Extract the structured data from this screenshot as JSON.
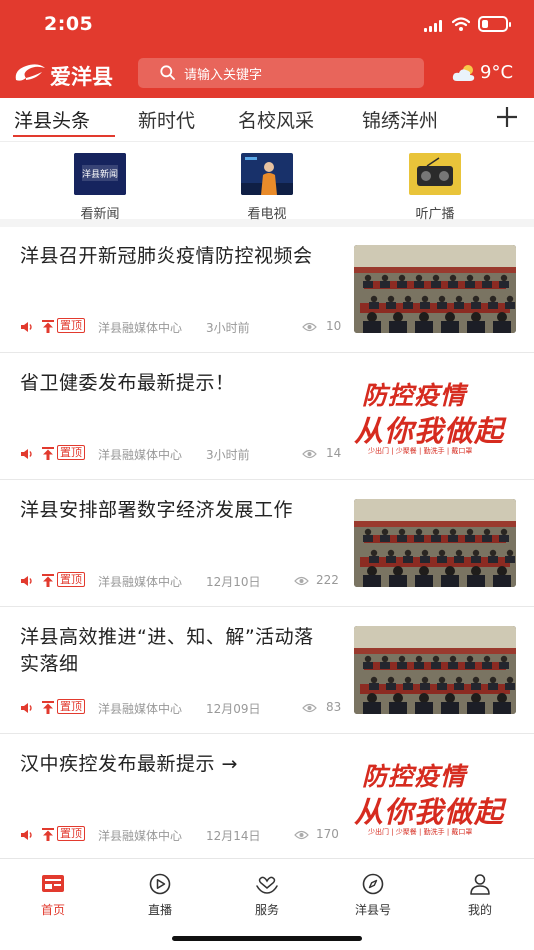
{
  "status_bar": {
    "time": "2:05",
    "battery_level": 0.25
  },
  "app": {
    "name": "爱洋县",
    "brand_color": "#e23a2e"
  },
  "search": {
    "placeholder": "请输入关键字"
  },
  "weather": {
    "icon": "partly-cloudy-icon",
    "temperature": "9°C"
  },
  "tabs": [
    {
      "label": "洋县头条",
      "active": true
    },
    {
      "label": "新时代",
      "active": false
    },
    {
      "label": "名校风采",
      "active": false
    },
    {
      "label": "锦绣洋州",
      "active": false
    }
  ],
  "quick_entries": [
    {
      "label": "看新闻",
      "thumb_text": "洋县新闻"
    },
    {
      "label": "看电视",
      "thumb_text": ""
    },
    {
      "label": "听广播",
      "thumb_text": ""
    }
  ],
  "news": [
    {
      "title": "洋县召开新冠肺炎疫情防控视频会",
      "pin": "置顶",
      "source": "洋县融媒体中心",
      "time": "3小时前",
      "views": "10",
      "thumb": "meeting-photo"
    },
    {
      "title": "省卫健委发布最新提示！",
      "pin": "置顶",
      "source": "洋县融媒体中心",
      "time": "3小时前",
      "views": "14",
      "thumb": "poster"
    },
    {
      "title": "洋县安排部署数字经济发展工作",
      "pin": "置顶",
      "source": "洋县融媒体中心",
      "time": "12月10日",
      "views": "222",
      "thumb": "meeting-photo"
    },
    {
      "title": "洋县高效推进“进、知、解”活动落实落细",
      "pin": "置顶",
      "source": "洋县融媒体中心",
      "time": "12月09日",
      "views": "83",
      "thumb": "meeting-photo"
    },
    {
      "title": "汉中疾控发布最新提示 →",
      "pin": "置顶",
      "source": "洋县融媒体中心",
      "time": "12月14日",
      "views": "170",
      "thumb": "poster"
    }
  ],
  "poster_text": {
    "line1": "防控疫情",
    "line2": "从你我做起",
    "line3": "少出门 | 少聚餐 | 勤洗手 | 戴口罩"
  },
  "bottom_nav": [
    {
      "label": "首页",
      "icon": "home-icon",
      "active": true
    },
    {
      "label": "直播",
      "icon": "live-icon",
      "active": false
    },
    {
      "label": "服务",
      "icon": "service-icon",
      "active": false
    },
    {
      "label": "洋县号",
      "icon": "compass-icon",
      "active": false
    },
    {
      "label": "我的",
      "icon": "user-icon",
      "active": false
    }
  ]
}
